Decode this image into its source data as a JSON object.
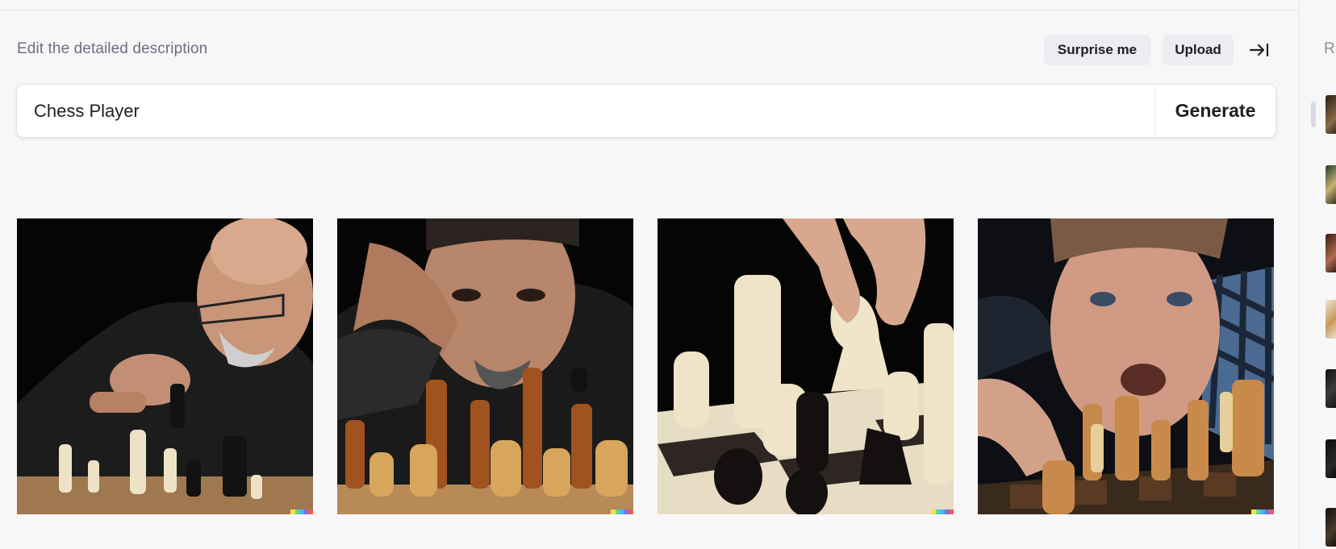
{
  "editor": {
    "heading": "Edit the detailed description",
    "surprise_label": "Surprise me",
    "upload_label": "Upload",
    "collapse_icon": "arrow-right-to-bar-icon"
  },
  "prompt": {
    "value": "Chess Player",
    "generate_label": "Generate"
  },
  "results": [
    {
      "name": "chess-player-image-1",
      "description": "older bald man with glasses moving a black piece"
    },
    {
      "name": "chess-player-image-2",
      "description": "man resting head on hand behind wooden pieces"
    },
    {
      "name": "chess-player-image-3",
      "description": "hand moving a white knight"
    },
    {
      "name": "chess-player-image-4",
      "description": "intense man leaning over the board"
    }
  ],
  "signature_colors": [
    "#f4e04d",
    "#5ed6a0",
    "#45b7e8",
    "#7d6cf0",
    "#ef5b5b"
  ],
  "sidebar": {
    "label": "R",
    "thumbnail_count": 7
  }
}
